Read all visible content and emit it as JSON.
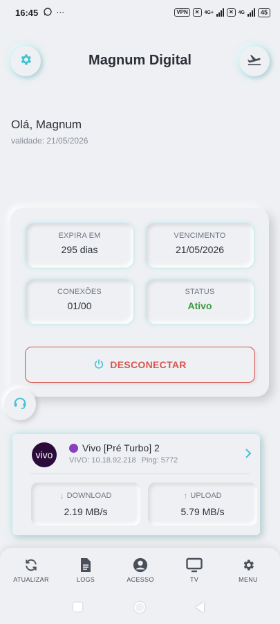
{
  "status_bar": {
    "time": "16:45",
    "vpn": "VPN",
    "net1": "4G+",
    "net2": "4G",
    "battery": "45"
  },
  "header": {
    "title": "Magnum Digital",
    "settings_icon": "gear-icon",
    "mode_icon": "airplane-icon"
  },
  "greeting": "Olá, Magnum",
  "validity": "validade: 21/05/2026",
  "stats": {
    "expires_label": "EXPIRA EM",
    "expires_value": "295 dias",
    "due_label": "VENCIMENTO",
    "due_value": "21/05/2026",
    "connections_label": "CONEXÕES",
    "connections_value": "01/00",
    "status_label": "STATUS",
    "status_value": "Ativo"
  },
  "disconnect_label": "DESCONECTAR",
  "server": {
    "logo_text": "vivo",
    "name": "Vivo [Pré Turbo] 2",
    "ip": "VIVO: 10.18.92.218",
    "ping": "Ping: 5772",
    "download_label": "DOWNLOAD",
    "download_value": "2.19 MB/s",
    "upload_label": "UPLOAD",
    "upload_value": "5.79 MB/s"
  },
  "nav": {
    "atualizar": "ATUALIZAR",
    "logs": "LOGS",
    "acesso": "ACESSO",
    "tv": "TV",
    "menu": "MENU"
  },
  "colors": {
    "accent": "#3fc3d6",
    "danger": "#d9534f",
    "success": "#3a9a3f",
    "background": "#eef0f3"
  }
}
